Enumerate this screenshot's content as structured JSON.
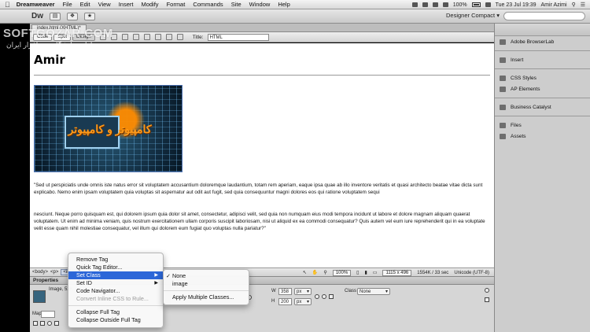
{
  "watermark": {
    "text": "SOFTGOZAR.COM",
    "subtitle": "اولین دانشگاه نرم افزار ایران"
  },
  "menubar": {
    "apple_icon": "apple-icon",
    "items": [
      "Dreamweaver",
      "File",
      "Edit",
      "View",
      "Insert",
      "Modify",
      "Format",
      "Commands",
      "Site",
      "Window",
      "Help"
    ],
    "battery": "100%",
    "clock": "Tue 23 Jul  19:39",
    "user": "Amir Azimi"
  },
  "appbar": {
    "logo": "Dw",
    "workspace": "Designer Compact"
  },
  "document": {
    "tab_label": "index.html (XHTML)*",
    "view_buttons": [
      "Code",
      "Split",
      "Design"
    ],
    "title_label": "Title:",
    "title_value": "HTML"
  },
  "design": {
    "heading": "Amir",
    "image_text": "کامپیوتر و کامپیوتر",
    "paragraph1": "\"Sed ut perspiciatis unde omnis iste natus error sit voluptatem accusantium doloremque laudantium, totam rem aperiam, eaque ipsa quae ab illo inventore veritatis et quasi architecto beatae vitae dicta sunt explicabo. Nemo enim ipsam voluptatem quia voluptas sit aspernatur aut odit aut fugit, sed quia consequuntur magni dolores eos qui ratione voluptatem sequi",
    "paragraph2": "nesciunt. Neque porro quisquam est, qui dolorem ipsum quia dolor sit amet, consectetur, adipisci velit, sed quia non numquam eius modi tempora incidunt ut labore et dolore magnam aliquam quaerat voluptatem. Ut enim ad minima veniam, quis nostrum exercitationem ullam corporis suscipit laboriosam, nisi ut aliquid ex ea commodi consequatur? Quis autem vel eum iure reprehenderit qui in ea voluptate velit esse quam nihil molestiae consequatur, vel illum qui dolorem eum fugiat quo voluptas nulla pariatur?\""
  },
  "tag_selector": {
    "tags": [
      "<body>",
      "<p>",
      "<img>"
    ],
    "zoom": "100%",
    "dimensions": "1115 x 496",
    "size": "1554K / 33 sec",
    "encoding": "Unicode (UTF-8)"
  },
  "properties": {
    "header": "Properties",
    "image_label": "Image, 52K",
    "w_label": "W",
    "w_value": "358",
    "h_label": "H",
    "h_value": "200",
    "unit": "px",
    "class_label": "Class",
    "class_value": "None",
    "map_label": "Map"
  },
  "right_panel": {
    "items": [
      "Adobe BrowserLab",
      "Insert",
      "CSS Styles",
      "AP Elements",
      "Business Catalyst",
      "Files",
      "Assets"
    ]
  },
  "context_menu": {
    "items": [
      "Remove Tag",
      "Quick Tag Editor...",
      "Set Class",
      "Set ID",
      "Code Navigator...",
      "Convert Inline CSS to Rule...",
      "Collapse Full Tag",
      "Collapse Outside Full Tag"
    ]
  },
  "submenu": {
    "items": [
      "None",
      "image",
      "Apply Multiple Classes..."
    ]
  },
  "colors": {
    "menu_highlight": "#2c67d8",
    "design_bg": "#ffffff",
    "chrome": "#d6d6d6"
  }
}
